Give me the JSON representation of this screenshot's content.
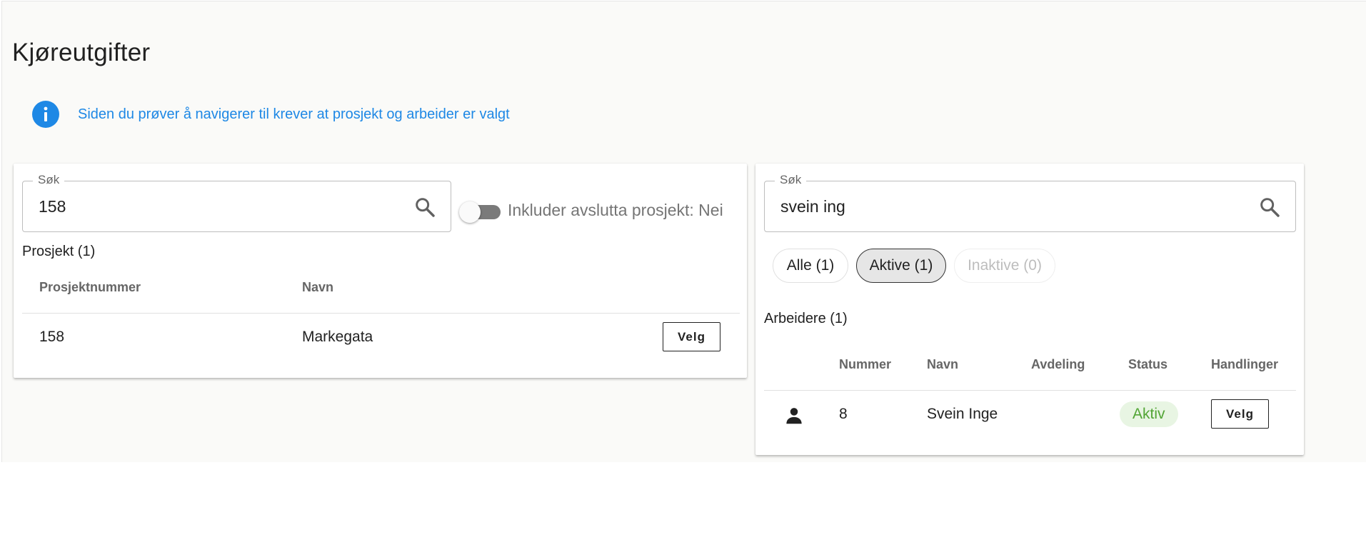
{
  "page": {
    "title": "Kjøreutgifter"
  },
  "info": {
    "message": "Siden du prøver å navigerer til krever at prosjekt og arbeider er valgt",
    "color": "#1e88e5"
  },
  "project_panel": {
    "search": {
      "legend": "Søk",
      "value": "158"
    },
    "toggle": {
      "label": "Inkluder avslutta prosjekt: Nei",
      "on": false
    },
    "section_title": "Prosjekt (1)",
    "columns": [
      "Prosjektnummer",
      "Navn"
    ],
    "rows": [
      {
        "number": "158",
        "name": "Markegata",
        "action": "Velg"
      }
    ]
  },
  "worker_panel": {
    "search": {
      "legend": "Søk",
      "value": "svein ing"
    },
    "filters": [
      {
        "label": "Alle (1)",
        "state": "normal"
      },
      {
        "label": "Aktive (1)",
        "state": "selected"
      },
      {
        "label": "Inaktive (0)",
        "state": "disabled"
      }
    ],
    "section_title": "Arbeidere (1)",
    "columns": [
      "Nummer",
      "Navn",
      "Avdeling",
      "Status",
      "Handlinger"
    ],
    "rows": [
      {
        "icon": "person-icon",
        "number": "8",
        "name": "Svein Inge",
        "department": "",
        "status": "Aktiv",
        "action": "Velg"
      }
    ]
  },
  "colors": {
    "status_active_bg": "#e8f5e3",
    "status_active_text": "#52a535",
    "accent": "#1e88e5"
  }
}
